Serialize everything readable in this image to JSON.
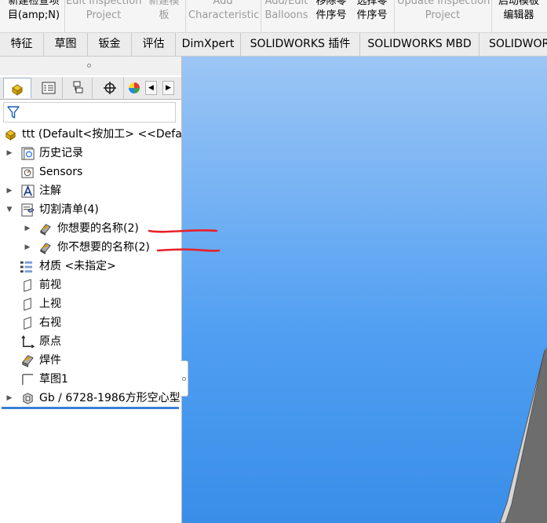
{
  "ribbon": {
    "buttons": [
      {
        "l1": "新建检查项",
        "l2": "目(amp;N)",
        "disabled": false
      },
      {
        "l1": "Edit Inspection",
        "l2": "Project",
        "disabled": true
      },
      {
        "l1": "新建模",
        "l2": "板",
        "disabled": true
      },
      {
        "l1": "Add",
        "l2": "Characteristic",
        "disabled": true
      },
      {
        "l1": "Add/Edit",
        "l2": "Balloons",
        "disabled": true
      },
      {
        "l1": "移除零",
        "l2": "件序号",
        "disabled": false
      },
      {
        "l1": "选择零",
        "l2": "件序号",
        "disabled": false
      },
      {
        "l1": "Update Inspection",
        "l2": "Project",
        "disabled": true
      },
      {
        "l1": "启动模板",
        "l2": "编辑器",
        "disabled": false
      }
    ]
  },
  "tabs": [
    "特征",
    "草图",
    "钣金",
    "评估",
    "DimXpert",
    "SOLIDWORKS 插件",
    "SOLIDWORKS MBD",
    "SOLIDWORKS"
  ],
  "manager_tabs": [
    "feature-manager",
    "property-manager",
    "configuration-manager",
    "dimxpert-manager",
    "display-manager"
  ],
  "tree": {
    "root": "ttt  (Default<按加工> <<Default",
    "items": [
      {
        "label": "历史记录",
        "icon": "history-icon",
        "expandable": true,
        "expanded": false
      },
      {
        "label": "Sensors",
        "icon": "sensors-icon",
        "expandable": false
      },
      {
        "label": "注解",
        "icon": "annotations-icon",
        "expandable": true,
        "expanded": false
      },
      {
        "label": "切割清单(4)",
        "icon": "cut-list-icon",
        "expandable": true,
        "expanded": true
      },
      {
        "label": "你想要的名称(2)",
        "icon": "cut-list-item-icon",
        "expandable": true,
        "expanded": false,
        "child": true
      },
      {
        "label": "你不想要的名称(2)",
        "icon": "cut-list-item-icon",
        "expandable": true,
        "expanded": false,
        "child": true
      },
      {
        "label": "材质 <未指定>",
        "icon": "material-icon",
        "expandable": false
      },
      {
        "label": "前视",
        "icon": "plane-icon",
        "expandable": false
      },
      {
        "label": "上视",
        "icon": "plane-icon",
        "expandable": false
      },
      {
        "label": "右视",
        "icon": "plane-icon",
        "expandable": false
      },
      {
        "label": "原点",
        "icon": "origin-icon",
        "expandable": false
      },
      {
        "label": "焊件",
        "icon": "weldment-icon",
        "expandable": false
      },
      {
        "label": "草图1",
        "icon": "sketch-icon",
        "expandable": false
      },
      {
        "label": "Gb / 6728-1986方形空心型",
        "icon": "structural-member-icon",
        "expandable": true,
        "expanded": false
      }
    ]
  },
  "colors": {
    "viewport_top": "#9cc6f5",
    "viewport_bottom": "#3a8ee8",
    "annotation_red": "#e8202a",
    "active_blue": "#3b7fd6"
  }
}
